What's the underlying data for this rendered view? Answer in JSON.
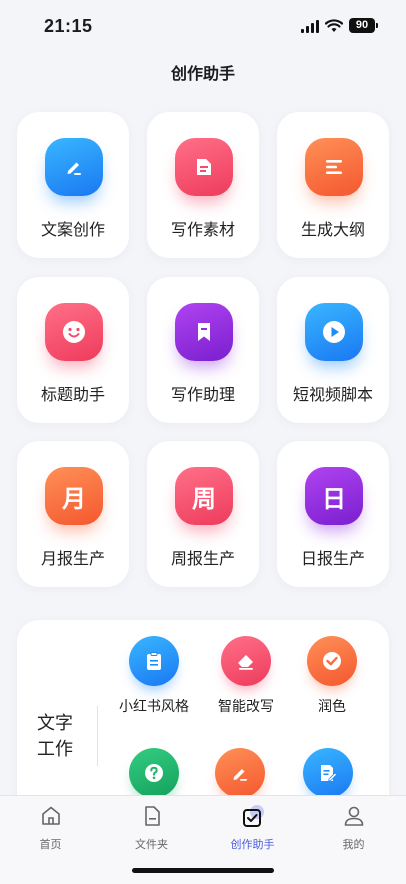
{
  "status": {
    "time": "21:15",
    "battery": "90"
  },
  "page": {
    "title": "创作助手"
  },
  "cards": [
    {
      "label": "文案创作",
      "icon": "pen-icon",
      "color": "#1e8cf8"
    },
    {
      "label": "写作素材",
      "icon": "document-icon",
      "color": "#f44b6b"
    },
    {
      "label": "生成大纲",
      "icon": "outline-icon",
      "color": "#fb6a3c"
    },
    {
      "label": "标题助手",
      "icon": "smile-icon",
      "color": "#f44b6b"
    },
    {
      "label": "写作助理",
      "icon": "bookmark-icon",
      "color": "#8e2ce0"
    },
    {
      "label": "短视频脚本",
      "icon": "play-icon",
      "color": "#1e8cf8"
    },
    {
      "label": "月报生产",
      "icon": "month-icon",
      "glyph": "月",
      "color": "#fb6a3c"
    },
    {
      "label": "周报生产",
      "icon": "week-icon",
      "glyph": "周",
      "color": "#f44b6b"
    },
    {
      "label": "日报生产",
      "icon": "day-icon",
      "glyph": "日",
      "color": "#8e2ce0"
    }
  ],
  "text_work": {
    "title_line1": "文字",
    "title_line2": "工作",
    "tools": [
      {
        "label": "小红书风格",
        "icon": "clipboard-icon",
        "color": "#1e8cf8"
      },
      {
        "label": "智能改写",
        "icon": "eraser-icon",
        "color": "#f44b6b"
      },
      {
        "label": "润色",
        "icon": "check-icon",
        "color": "#fb6a3c"
      },
      {
        "label": "",
        "icon": "question-icon",
        "color": "#22b36b"
      },
      {
        "label": "",
        "icon": "pen-icon",
        "color": "#fb6a3c"
      },
      {
        "label": "",
        "icon": "doc-edit-icon",
        "color": "#1e8cf8"
      }
    ]
  },
  "tabs": [
    {
      "label": "首页",
      "icon": "home-icon"
    },
    {
      "label": "文件夹",
      "icon": "folder-icon"
    },
    {
      "label": "创作助手",
      "icon": "create-assistant-icon",
      "active": true
    },
    {
      "label": "我的",
      "icon": "profile-icon"
    }
  ],
  "colors": {
    "accent": "#4a5bdc"
  }
}
